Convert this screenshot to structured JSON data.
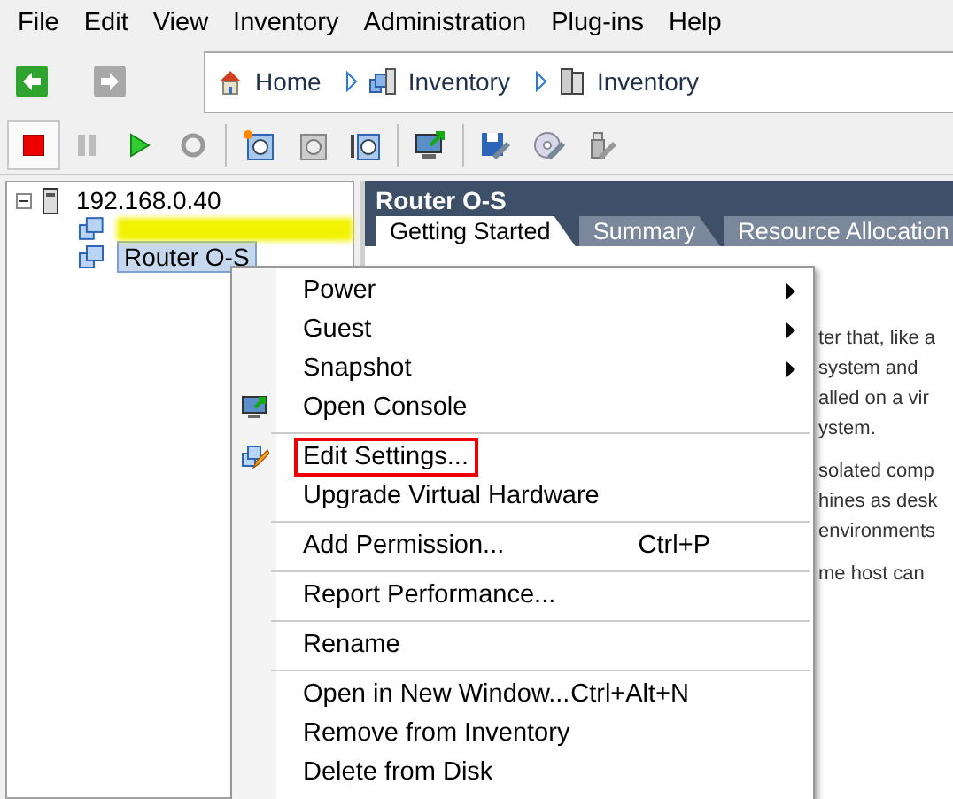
{
  "menu_bar": [
    "File",
    "Edit",
    "View",
    "Inventory",
    "Administration",
    "Plug-ins",
    "Help"
  ],
  "breadcrumb": [
    {
      "kind": "home",
      "label": "Home"
    },
    {
      "kind": "datacenter",
      "label": "Inventory"
    },
    {
      "kind": "host",
      "label": "Inventory"
    }
  ],
  "tree": {
    "label": "192.168.0.40",
    "expanded": true,
    "children": [
      {
        "kind": "redacted",
        "selected": false
      },
      {
        "kind": "vm",
        "label": "Router O-S",
        "selected": true
      }
    ]
  },
  "panel": {
    "title": "Router O-S",
    "tabs": [
      {
        "label": "Getting Started",
        "selected": true
      },
      {
        "label": "Summary",
        "selected": false
      },
      {
        "label": "Resource Allocation",
        "selected": false
      }
    ],
    "paragraphs": [
      [
        "ter that, like a",
        "system and",
        "alled on a vir",
        "ystem."
      ],
      [
        "solated comp",
        "hines as desk",
        "environments"
      ],
      [
        "me host can"
      ]
    ]
  },
  "context_menu": [
    [
      {
        "kind": "plain",
        "label": "Power",
        "submenu": true,
        "highlighted": false
      },
      {
        "kind": "plain",
        "label": "Guest",
        "submenu": true,
        "highlighted": false
      },
      {
        "kind": "plain",
        "label": "Snapshot",
        "submenu": true,
        "highlighted": false
      },
      {
        "kind": "console",
        "label": "Open Console",
        "submenu": false,
        "highlighted": false
      }
    ],
    [
      {
        "kind": "edit",
        "label": "Edit Settings...",
        "submenu": false,
        "highlighted": true
      },
      {
        "kind": "plain",
        "label": "Upgrade Virtual Hardware",
        "submenu": false,
        "highlighted": false
      }
    ],
    [
      {
        "kind": "plain",
        "label": "Add Permission...",
        "submenu": false,
        "highlighted": false,
        "shortcut": "Ctrl+P"
      }
    ],
    [
      {
        "kind": "plain",
        "label": "Report Performance...",
        "submenu": false,
        "highlighted": false
      }
    ],
    [
      {
        "kind": "plain",
        "label": "Rename",
        "submenu": false,
        "highlighted": false
      }
    ],
    [
      {
        "kind": "plain",
        "label": "Open in New Window...",
        "submenu": false,
        "highlighted": false,
        "shortcut": "Ctrl+Alt+N"
      },
      {
        "kind": "plain",
        "label": "Remove from Inventory",
        "submenu": false,
        "highlighted": false
      },
      {
        "kind": "plain",
        "label": "Delete from Disk",
        "submenu": false,
        "highlighted": false
      }
    ]
  ]
}
